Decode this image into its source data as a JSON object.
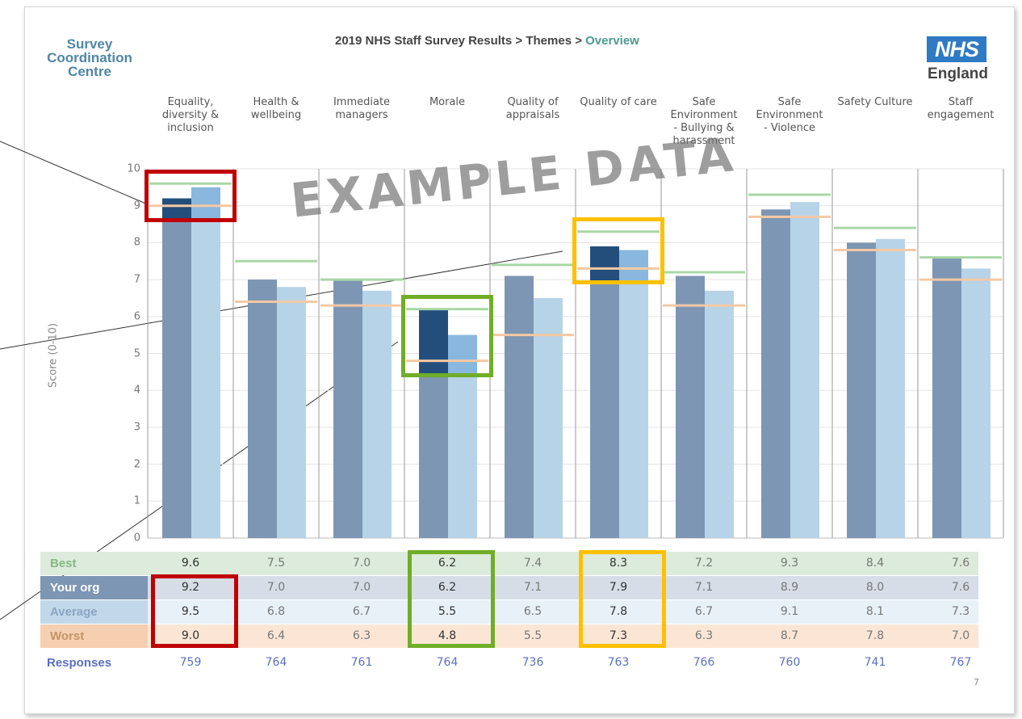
{
  "header": {
    "logo_lines": [
      "Survey",
      "Coordination",
      "Centre"
    ],
    "breadcrumb_prefix": "2019 NHS Staff Survey Results > Themes > ",
    "breadcrumb_current": "Overview",
    "nhs_logo": "NHS",
    "nhs_logo_sub": "England"
  },
  "watermark": "EXAMPLE DATA",
  "page_number": "7",
  "colors": {
    "your_org": "#7d96b3",
    "average": "#b7d3e8",
    "your_org_highlight": "#234e7c",
    "average_highlight": "#8ab7dd",
    "best": "#a9d7a6",
    "worst": "#f5c9a4",
    "highlight_red": "#c00000",
    "highlight_green": "#70ad28",
    "highlight_amber": "#ffc000"
  },
  "chart_data": {
    "type": "bar",
    "ylabel": "Score (0-10)",
    "ylim": [
      0,
      10
    ],
    "yticks": [
      0,
      1,
      2,
      3,
      4,
      5,
      6,
      7,
      8,
      9,
      10
    ],
    "categories": [
      "Equality, diversity & inclusion",
      "Health & wellbeing",
      "Immediate managers",
      "Morale",
      "Quality of appraisals",
      "Quality of care",
      "Safe Environment - Bullying & harassment",
      "Safe Environment - Violence",
      "Safety Culture",
      "Staff engagement"
    ],
    "category_label_lines": [
      [
        "Equality,",
        "diversity &",
        "inclusion"
      ],
      [
        "Health &",
        "wellbeing"
      ],
      [
        "Immediate",
        "managers"
      ],
      [
        "Morale"
      ],
      [
        "Quality of",
        "appraisals"
      ],
      [
        "Quality of care"
      ],
      [
        "Safe",
        "Environment",
        "- Bullying &",
        "harassment"
      ],
      [
        "Safe",
        "Environment",
        "- Violence"
      ],
      [
        "Safety Culture"
      ],
      [
        "Staff",
        "engagement"
      ]
    ],
    "series": [
      {
        "name": "Best",
        "values": [
          9.6,
          7.5,
          7.0,
          6.2,
          7.4,
          8.3,
          7.2,
          9.3,
          8.4,
          7.6
        ]
      },
      {
        "name": "Your org",
        "values": [
          9.2,
          7.0,
          7.0,
          6.2,
          7.1,
          7.9,
          7.1,
          8.9,
          8.0,
          7.6
        ]
      },
      {
        "name": "Average",
        "values": [
          9.5,
          6.8,
          6.7,
          5.5,
          6.5,
          7.8,
          6.7,
          9.1,
          8.1,
          7.3
        ]
      },
      {
        "name": "Worst",
        "values": [
          9.0,
          6.4,
          6.3,
          4.8,
          5.5,
          7.3,
          6.3,
          8.7,
          7.8,
          7.0
        ]
      }
    ],
    "table_values": {
      "Best": [
        "9.6",
        "7.5",
        "7.0",
        "6.2",
        "7.4",
        "8.3",
        "7.2",
        "9.3",
        "8.4",
        "7.6"
      ],
      "Your org": [
        "9.2",
        "7.0",
        "7.0",
        "6.2",
        "7.1",
        "7.9",
        "7.1",
        "8.9",
        "8.0",
        "7.6"
      ],
      "Average": [
        "9.5",
        "6.8",
        "6.7",
        "5.5",
        "6.5",
        "7.8",
        "6.7",
        "9.1",
        "8.1",
        "7.3"
      ],
      "Worst": [
        "9.0",
        "6.4",
        "6.3",
        "4.8",
        "5.5",
        "7.3",
        "6.3",
        "8.7",
        "7.8",
        "7.0"
      ]
    },
    "responses_label": "Responses",
    "responses": [
      "759",
      "764",
      "761",
      "764",
      "736",
      "763",
      "766",
      "760",
      "741",
      "767"
    ],
    "highlighted_categories": [
      {
        "category": "Equality, diversity & inclusion",
        "color": "red"
      },
      {
        "category": "Morale",
        "color": "green"
      },
      {
        "category": "Quality of care",
        "color": "amber"
      }
    ]
  }
}
